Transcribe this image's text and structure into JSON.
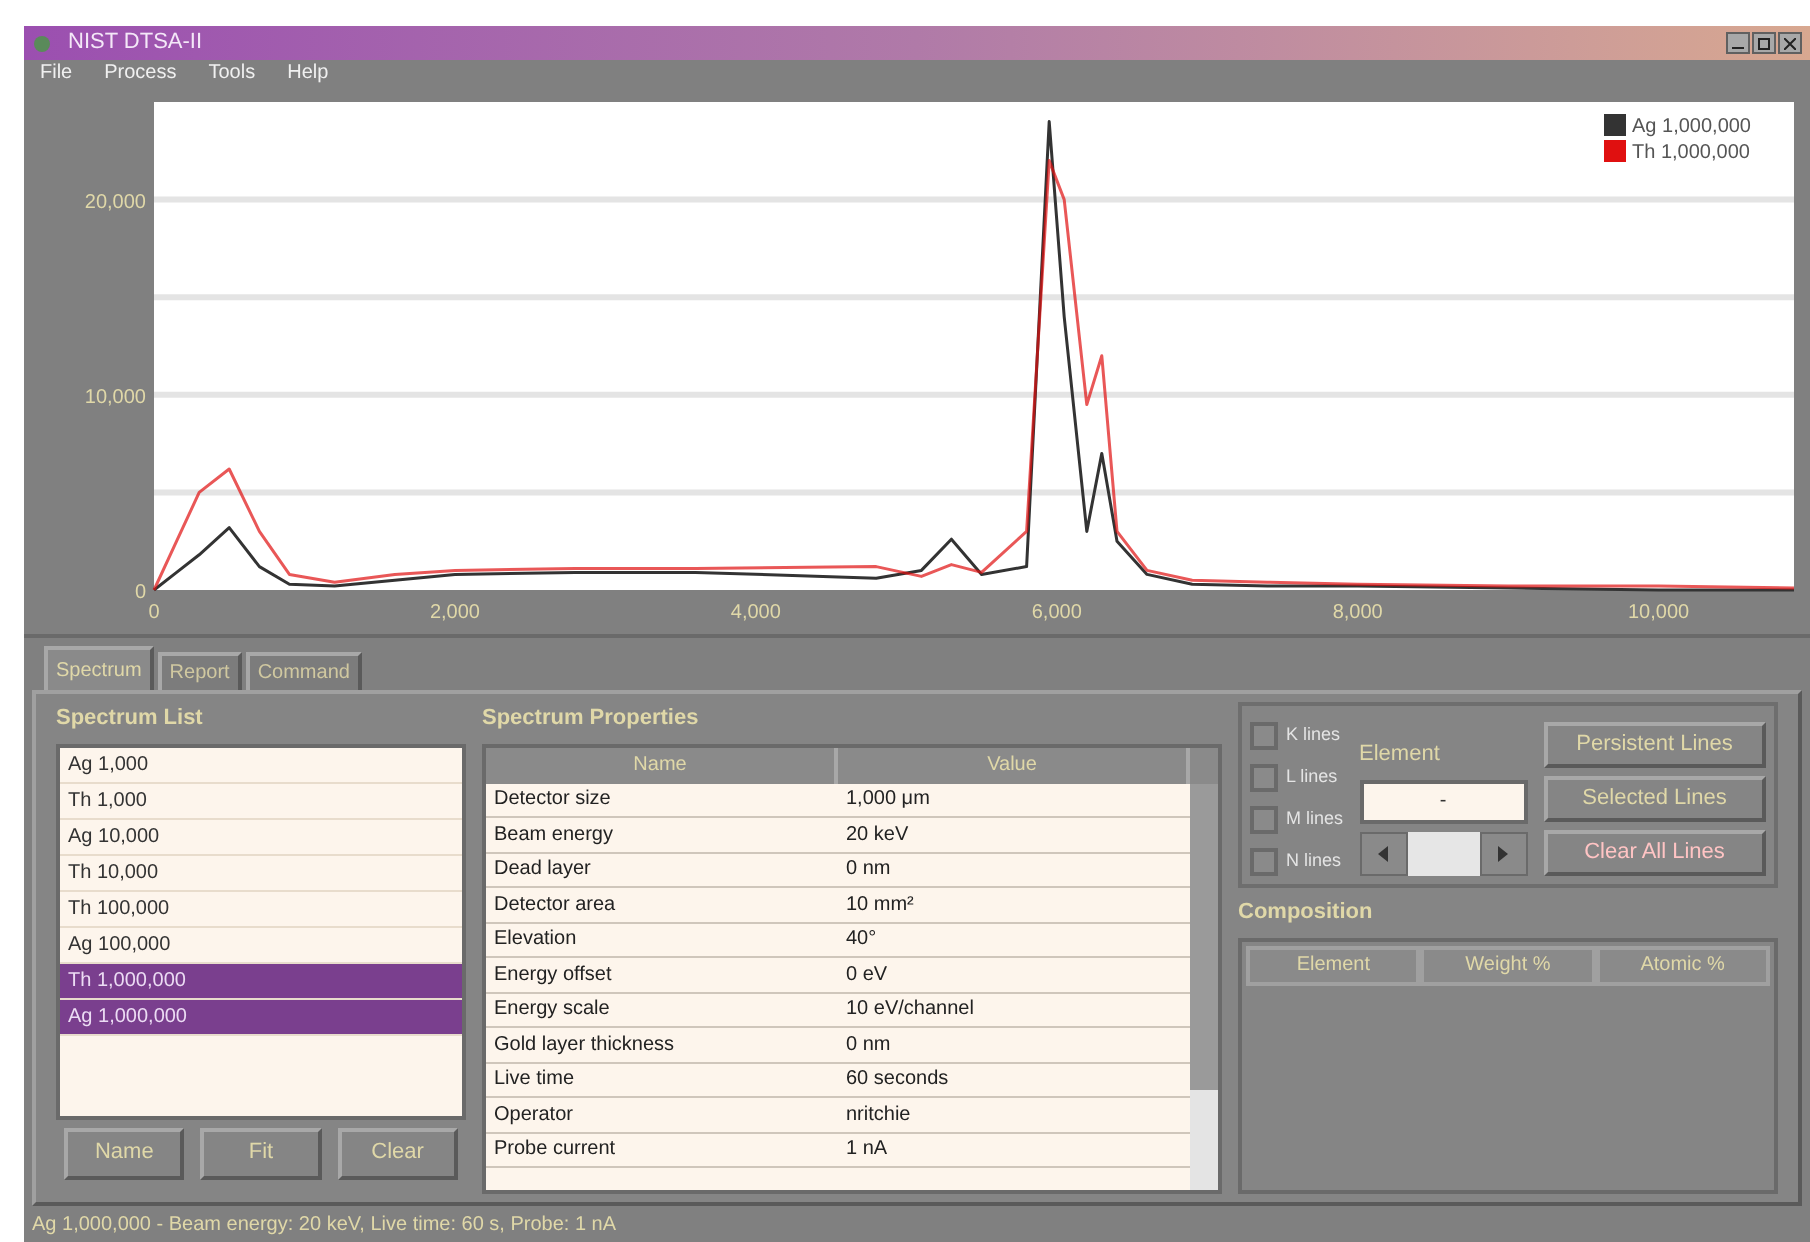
{
  "window": {
    "title": "NIST DTSA-II"
  },
  "menu": [
    "File",
    "Process",
    "Tools",
    "Help"
  ],
  "chart_data": {
    "type": "line",
    "legend": true,
    "xlim": [
      0,
      10900
    ],
    "ylim": [
      0,
      25000
    ],
    "xticks": [
      {
        "value": 0,
        "label": "0"
      },
      {
        "value": 2000,
        "label": "2,000"
      },
      {
        "value": 4000,
        "label": "4,000"
      },
      {
        "value": 6000,
        "label": "6,000"
      },
      {
        "value": 8000,
        "label": "8,000"
      },
      {
        "value": 10000,
        "label": "10,000"
      }
    ],
    "yticks": [
      {
        "value": 0,
        "label": "0"
      },
      {
        "value": 10000,
        "label": "10,000"
      },
      {
        "value": 20000,
        "label": "20,000"
      }
    ],
    "x": [
      0,
      150,
      300,
      500,
      700,
      900,
      1200,
      1600,
      2000,
      2800,
      3600,
      4800,
      5100,
      5300,
      5500,
      5800,
      5950,
      6050,
      6200,
      6300,
      6400,
      6600,
      6900,
      7400,
      8000,
      9000,
      10000,
      10900
    ],
    "series": [
      {
        "name": "Ag 1,000,000",
        "color": "#333333",
        "values": [
          0,
          900,
          1800,
          3200,
          1200,
          300,
          200,
          500,
          800,
          900,
          900,
          600,
          1000,
          2600,
          800,
          1200,
          24000,
          14000,
          3000,
          7000,
          2500,
          800,
          300,
          200,
          200,
          100,
          0,
          0
        ]
      },
      {
        "name": "Th 1,000,000",
        "color": "#e01010",
        "values": [
          0,
          2500,
          5000,
          6200,
          3000,
          800,
          400,
          800,
          1000,
          1100,
          1100,
          1200,
          700,
          1300,
          900,
          3000,
          22000,
          20000,
          9500,
          12000,
          3000,
          1000,
          500,
          400,
          300,
          200,
          200,
          100
        ]
      }
    ]
  },
  "tabs": [
    {
      "label": "Spectrum",
      "selected": true
    },
    {
      "label": "Report",
      "selected": false
    },
    {
      "label": "Command",
      "selected": false
    }
  ],
  "spectrum_list": {
    "title": "Spectrum List",
    "items": [
      {
        "label": "Ag 1,000",
        "selected": false
      },
      {
        "label": "Th 1,000",
        "selected": false
      },
      {
        "label": "Ag 10,000",
        "selected": false
      },
      {
        "label": "Th 10,000",
        "selected": false
      },
      {
        "label": "Th 100,000",
        "selected": false
      },
      {
        "label": "Ag 100,000",
        "selected": false
      },
      {
        "label": "Th 1,000,000",
        "selected": true
      },
      {
        "label": "Ag 1,000,000",
        "selected": true
      }
    ],
    "buttons": [
      "Name",
      "Fit",
      "Clear"
    ]
  },
  "properties": {
    "title": "Spectrum Properties",
    "columns": [
      "Name",
      "Value"
    ],
    "rows": [
      [
        "Detector size",
        "1,000 μm"
      ],
      [
        "Beam energy",
        "20 keV"
      ],
      [
        "Dead layer",
        "0 nm"
      ],
      [
        "Detector area",
        "10 mm²"
      ],
      [
        "Elevation",
        "40°"
      ],
      [
        "Energy offset",
        "0 eV"
      ],
      [
        "Energy scale",
        "10 eV/channel"
      ],
      [
        "Gold layer thickness",
        "0 nm"
      ],
      [
        "Live time",
        "60 seconds"
      ],
      [
        "Operator",
        "nritchie"
      ],
      [
        "Probe current",
        "1 nA"
      ]
    ]
  },
  "lines": {
    "checkboxes": [
      {
        "label": "K lines",
        "checked": false
      },
      {
        "label": "L lines",
        "checked": false
      },
      {
        "label": "M lines",
        "checked": false
      },
      {
        "label": "N lines",
        "checked": false
      }
    ],
    "element_label": "Element",
    "element_value": "-",
    "buttons": [
      {
        "label": "Persistent Lines",
        "kind": "normal"
      },
      {
        "label": "Selected Lines",
        "kind": "normal"
      },
      {
        "label": "Clear All Lines",
        "kind": "danger"
      }
    ]
  },
  "composition": {
    "title": "Composition",
    "columns": [
      "Element",
      "Weight %",
      "Atomic %"
    ]
  },
  "status_bar": "Ag 1,000,000 - Beam energy: 20 keV, Live time: 60 s, Probe: 1 nA"
}
